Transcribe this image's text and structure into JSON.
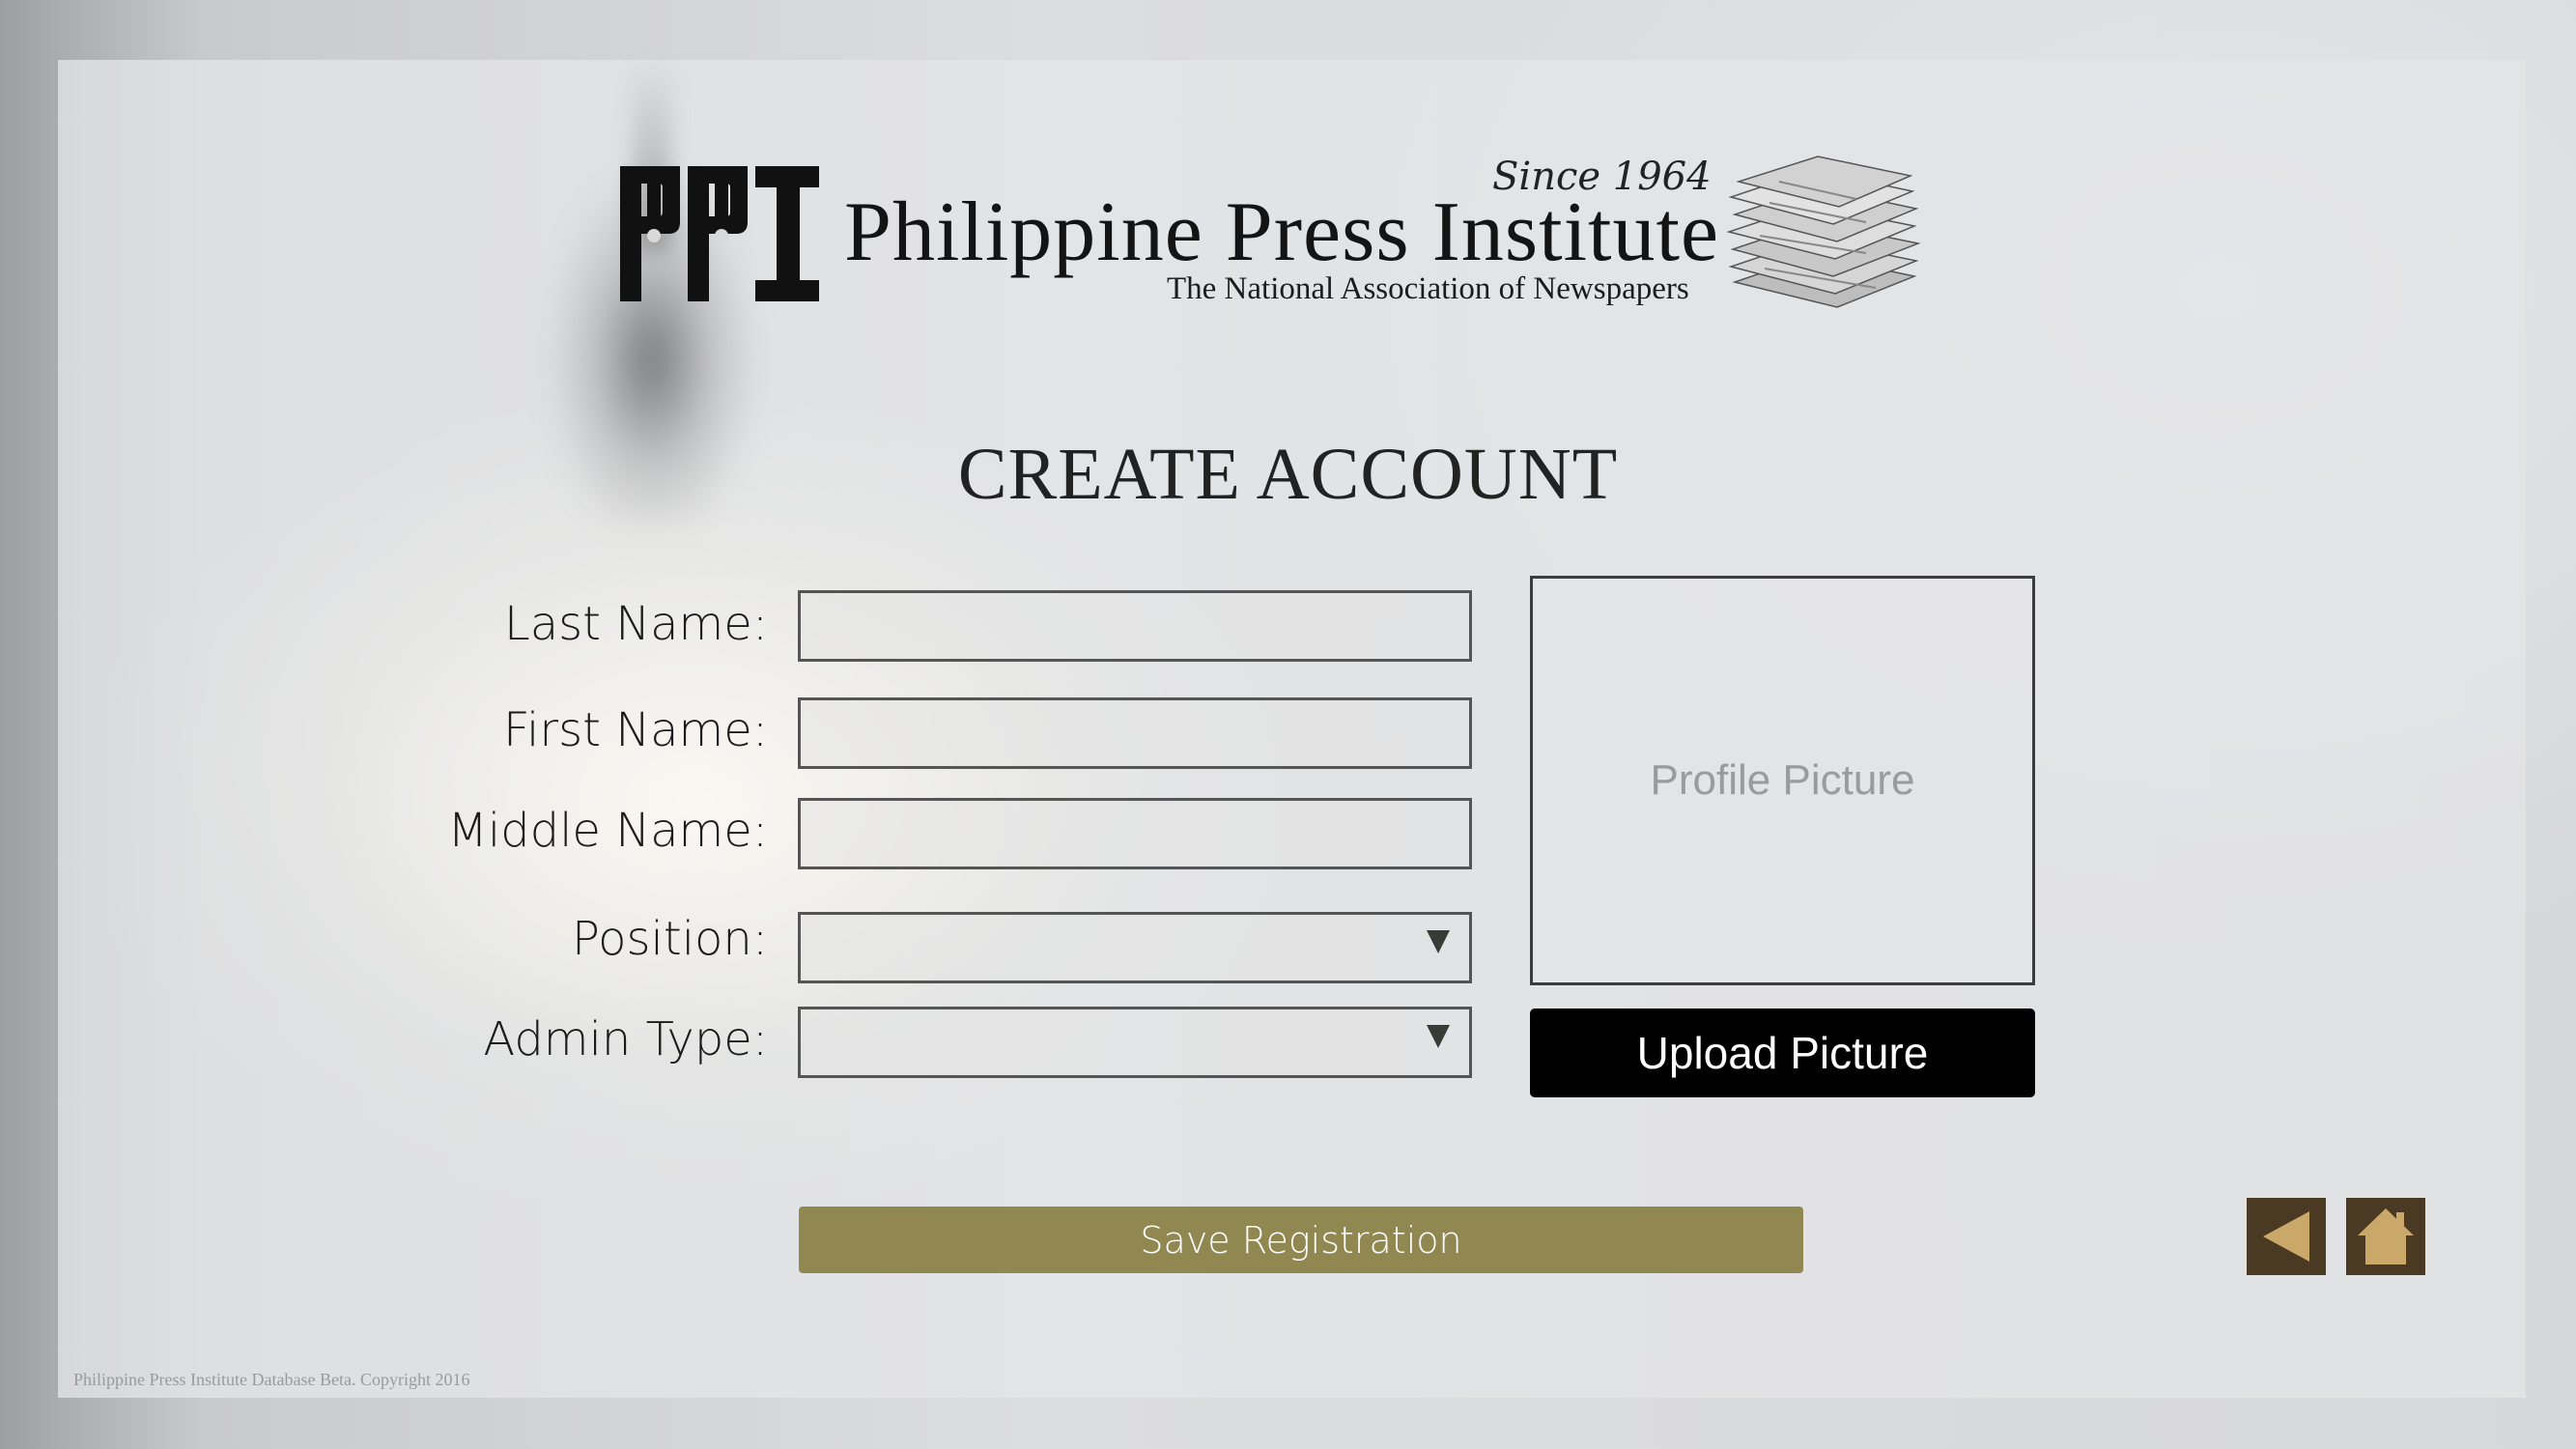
{
  "header": {
    "logo_letters": "PPI",
    "since": "Since 1964",
    "brand_name": "Philippine Press Institute",
    "tagline": "The National Association of Newspapers"
  },
  "page_title": "CREATE ACCOUNT",
  "form": {
    "last_name_label": "Last Name:",
    "first_name_label": "First Name:",
    "middle_name_label": "Middle Name:",
    "position_label": "Position:",
    "admin_type_label": "Admin Type:",
    "last_name_value": "",
    "first_name_value": "",
    "middle_name_value": "",
    "position_value": "",
    "admin_type_value": ""
  },
  "profile": {
    "placeholder": "Profile Picture",
    "upload_label": "Upload Picture"
  },
  "actions": {
    "save_label": "Save Registration",
    "back_icon": "back-arrow-icon",
    "home_icon": "home-icon"
  },
  "footer": {
    "copyright": "Philippine Press Institute Database Beta. Copyright 2016"
  },
  "colors": {
    "save_button": "#918751",
    "nav_button": "#4a3a24",
    "nav_icon": "#c9a86a",
    "upload_button": "#000000"
  }
}
